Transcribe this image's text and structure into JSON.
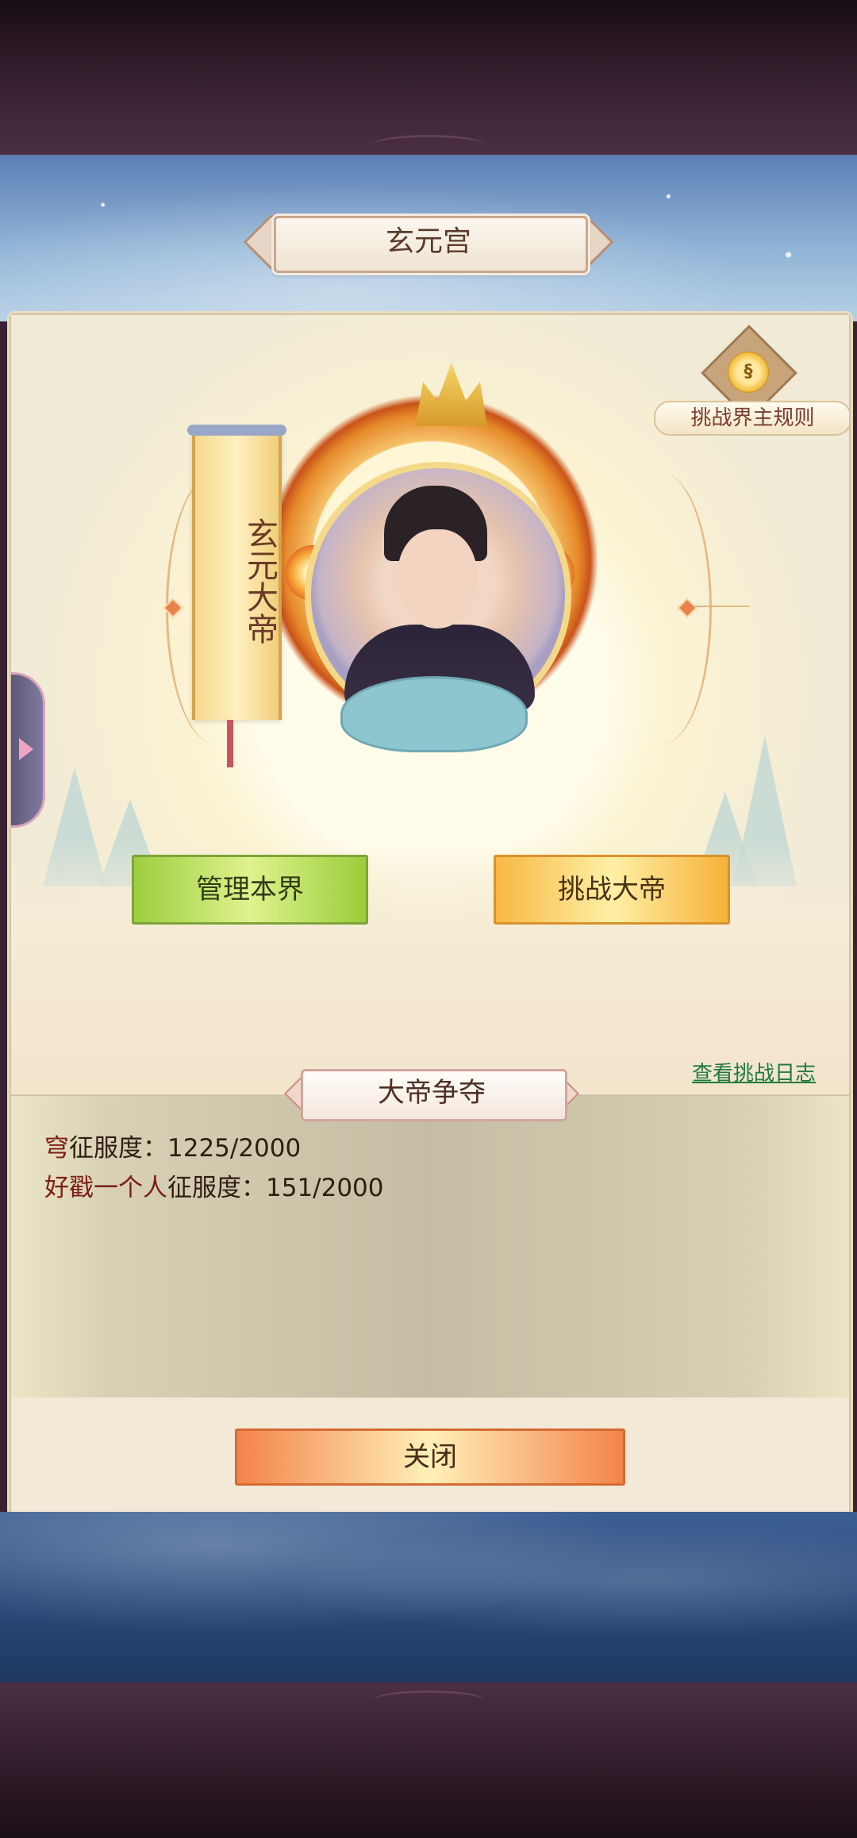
{
  "dialog": {
    "title": "玄元宫",
    "rules_label": "挑战界主规则",
    "rules_icon": "scroll-rules-icon"
  },
  "emperor": {
    "banner_title": "玄元大帝"
  },
  "actions": {
    "manage_label": "管理本界",
    "challenge_label": "挑战大帝",
    "log_link": "查看挑战日志",
    "close_label": "关闭"
  },
  "section": {
    "title": "大帝争夺",
    "lines": [
      {
        "label": "穹",
        "text": "征服度：1225/2000"
      },
      {
        "label": "好戳一个人",
        "text": "征服度：151/2000"
      }
    ]
  },
  "colors": {
    "accent_green": "#9dce3f",
    "accent_gold": "#f7b842",
    "accent_orange": "#f3844a",
    "link": "#1f7a3f",
    "name_red": "#7c1d1a"
  }
}
